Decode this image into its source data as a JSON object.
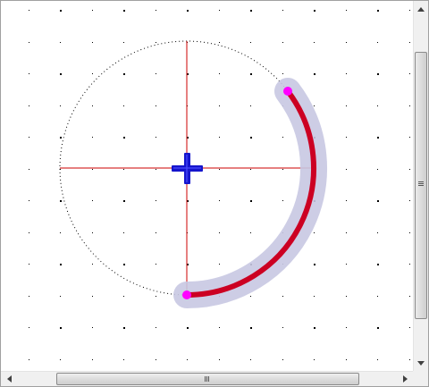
{
  "canvas": {
    "background_color": "#ffffff",
    "grid_marker_color": "#000000",
    "crosshair_color": "#cc0000",
    "guide_circle_color": "#000000",
    "arc_color": "#cc0022",
    "arc_highlight_color": "#c8c8e2",
    "endpoint_color": "#ff00ff",
    "center_marker_color": "#1515cc",
    "icons": {
      "center": "move-cross-icon",
      "arc_start": "endpoint-handle-icon",
      "arc_end": "endpoint-handle-icon"
    }
  },
  "scrollbars": {
    "vertical": {
      "up_icon": "arrow-up-icon",
      "down_icon": "arrow-down-icon",
      "thumb_icon": "grip-icon"
    },
    "horizontal": {
      "left_icon": "arrow-left-icon",
      "right_icon": "arrow-right-icon",
      "thumb_icon": "grip-icon"
    }
  }
}
